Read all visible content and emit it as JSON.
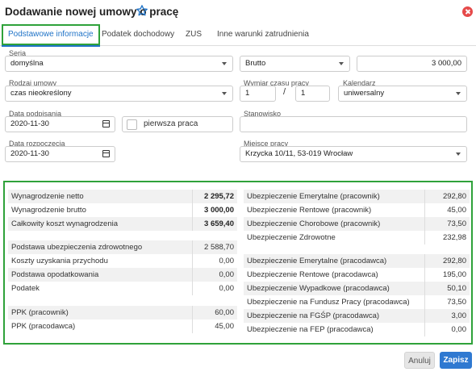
{
  "dialog": {
    "title": "Dodawanie nowej umowy o pracę"
  },
  "tabs": [
    {
      "label": "Podstawowe informacje"
    },
    {
      "label": "Podatek dochodowy"
    },
    {
      "label": "ZUS"
    },
    {
      "label": "Inne warunki zatrudnienia"
    }
  ],
  "form": {
    "seria": {
      "label": "Seria",
      "value": "domyślna"
    },
    "brutto_type": {
      "value": "Brutto"
    },
    "amount": {
      "value": "3 000,00"
    },
    "rodzaj": {
      "label": "Rodzaj umowy",
      "value": "czas nieokreślony"
    },
    "wymiar": {
      "label": "Wymiar czasu pracy",
      "num": "1",
      "sep": "/",
      "den": "1"
    },
    "kalendarz": {
      "label": "Kalendarz",
      "value": "uniwersalny"
    },
    "data_podpisania": {
      "label": "Data podpisania",
      "value": "2020-11-30"
    },
    "pierwsza_praca": {
      "label": "pierwsza praca"
    },
    "stanowisko": {
      "label": "Stanowisko",
      "value": ""
    },
    "data_rozpoczecia": {
      "label": "Data rozpoczęcia",
      "value": "2020-11-30"
    },
    "miejsce": {
      "label": "Miejsce pracy",
      "value": "Krzycka 10/11, 53-019 Wrocław"
    }
  },
  "summary": {
    "left": [
      {
        "label": "Wynagrodzenie netto",
        "value": "2 295,72"
      },
      {
        "label": "Wynagrodzenie brutto",
        "value": "3 000,00"
      },
      {
        "label": "Całkowity koszt wynagrodzenia",
        "value": "3 659,40"
      },
      {
        "label": "Podstawa ubezpieczenia zdrowotnego",
        "value": "2 588,70"
      },
      {
        "label": "Koszty uzyskania przychodu",
        "value": "0,00"
      },
      {
        "label": "Podstawa opodatkowania",
        "value": "0,00"
      },
      {
        "label": "Podatek",
        "value": "0,00"
      },
      {
        "label": "PPK (pracownik)",
        "value": "60,00"
      },
      {
        "label": "PPK (pracodawca)",
        "value": "45,00"
      }
    ],
    "right": [
      {
        "label": "Ubezpieczenie Emerytalne (pracownik)",
        "value": "292,80"
      },
      {
        "label": "Ubezpieczenie Rentowe (pracownik)",
        "value": "45,00"
      },
      {
        "label": "Ubezpieczenie Chorobowe (pracownik)",
        "value": "73,50"
      },
      {
        "label": "Ubezpieczenie Zdrowotne",
        "value": "232,98"
      },
      {
        "label": "Ubezpieczenie Emerytalne (pracodawca)",
        "value": "292,80"
      },
      {
        "label": "Ubezpieczenie Rentowe (pracodawca)",
        "value": "195,00"
      },
      {
        "label": "Ubezpieczenie Wypadkowe (pracodawca)",
        "value": "50,10"
      },
      {
        "label": "Ubezpieczenie na Fundusz Pracy (pracodawca)",
        "value": "73,50"
      },
      {
        "label": "Ubezpieczenie na FGŚP (pracodawca)",
        "value": "3,00"
      },
      {
        "label": "Ubezpieczenie na FEP (pracodawca)",
        "value": "0,00"
      }
    ]
  },
  "footer": {
    "cancel_label": "Anuluj",
    "save_label": "Zapisz"
  },
  "colors": {
    "accent": "#1f73c7",
    "highlight": "#2fa23a",
    "primary_button": "#2f79d1",
    "close": "#e64a4a"
  }
}
